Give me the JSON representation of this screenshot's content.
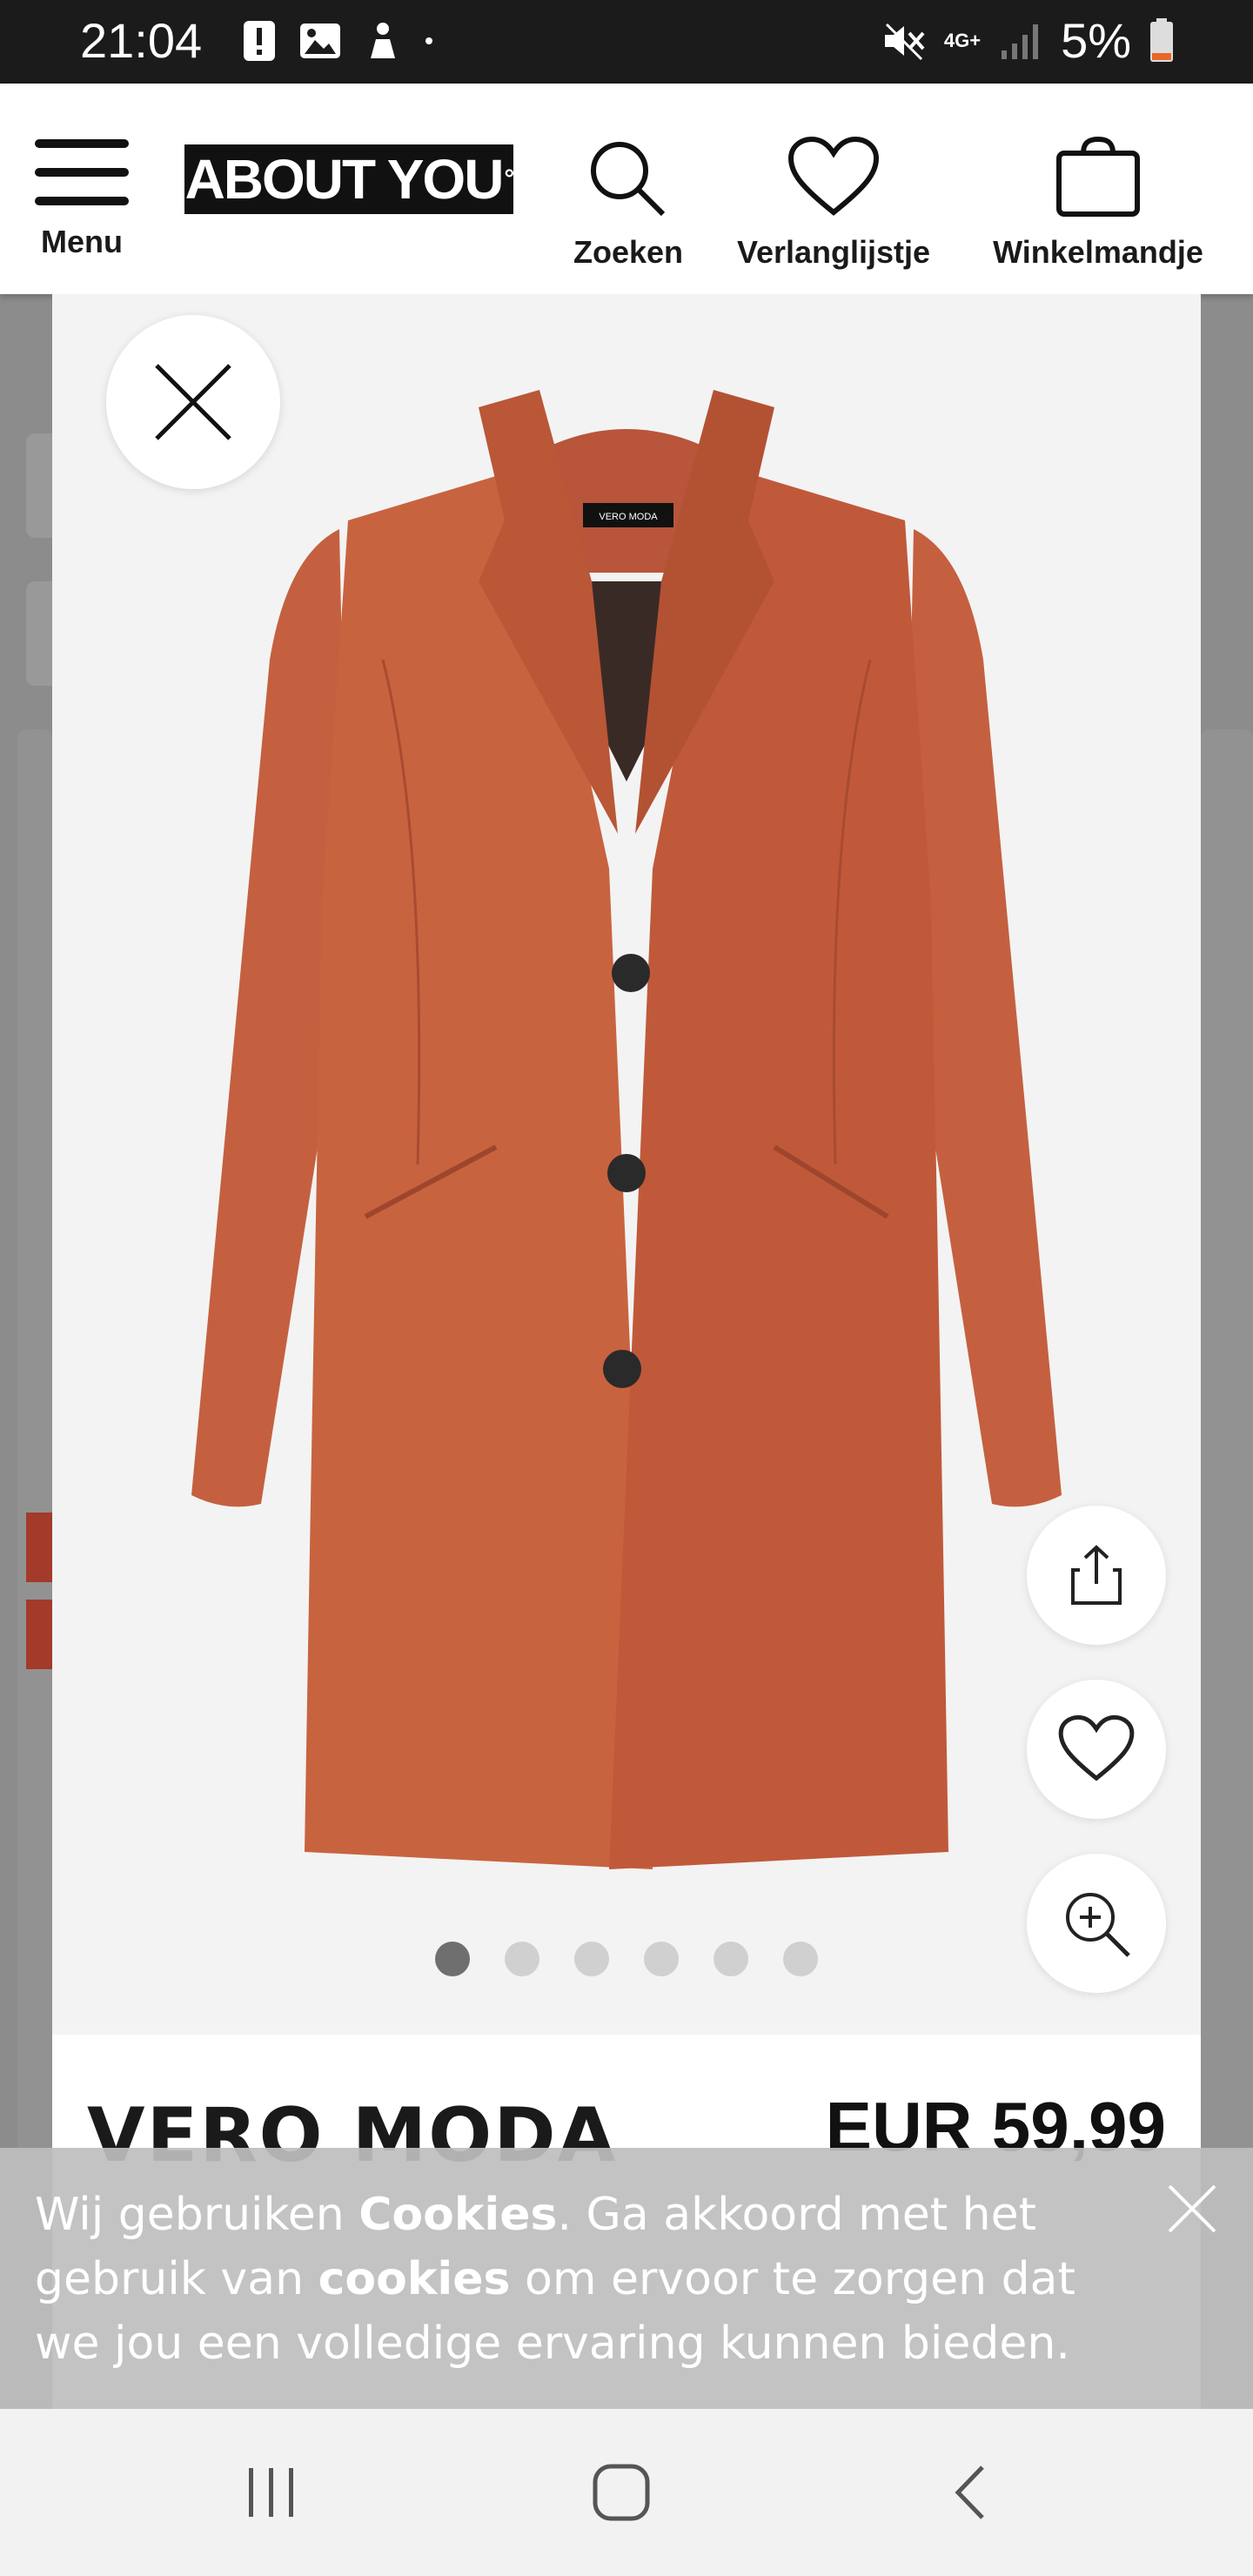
{
  "status_bar": {
    "time": "21:04",
    "network": "4G+",
    "battery_percent": "5%",
    "battery_color": "#e8672a"
  },
  "header": {
    "menu_label": "Menu",
    "logo_text": "ABOUT YOU",
    "search_label": "Zoeken",
    "wishlist_label": "Verlanglijstje",
    "cart_label": "Winkelmandje"
  },
  "product": {
    "brand": "VERO MODA",
    "price": "EUR 59,99",
    "image_count": 6,
    "active_image": 1,
    "coat_color": "#c4603f",
    "garment_label": "VERO MODA"
  },
  "cookie_banner": {
    "text_1": "Wij gebruiken ",
    "bold_1": "Cookies",
    "text_2": ". Ga akkoord met het gebruik van ",
    "bold_2": "cookies",
    "text_3": " om ervoor te zorgen dat we jou een volledige ervaring kunnen bieden."
  },
  "icons": {
    "close": "close-icon",
    "share": "share-icon",
    "wishlist": "heart-icon",
    "zoom": "zoom-in-icon"
  }
}
